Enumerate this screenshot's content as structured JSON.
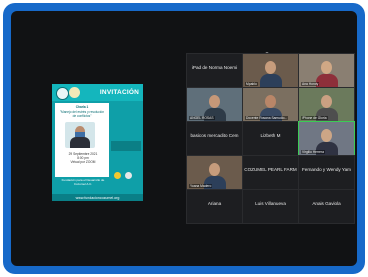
{
  "shared_screen": {
    "heading": "INVITACIÓN",
    "title_top": "Charla 1",
    "title": "\"Manejo del estrés y resolución de conflictos\"",
    "date": "29 Septiembre 2021",
    "time": "8:00 pm",
    "mode": "Virtual por ZOOM",
    "org": "Fundación para el Desarrollo de Cozumel A.C.",
    "footer": "www.fundacioncozumel.org"
  },
  "gallery": {
    "up_arrow": "︿",
    "down_arrow": "﹀",
    "tiles": [
      {
        "label": "iPad de Norma Noemi",
        "video": false
      },
      {
        "label": "Mpablo",
        "video": true
      },
      {
        "label": "Ana Hondy",
        "video": true
      },
      {
        "label": "ANGEL ROSAS",
        "video": true
      },
      {
        "label": "Docente Rosana Samudio...",
        "video": true
      },
      {
        "label": "iPhone de Gloria",
        "video": true
      },
      {
        "label": "basicos mercadito Cem",
        "video": false
      },
      {
        "label": "Lizbeth M",
        "video": false
      },
      {
        "label": "Virgilio Herrera",
        "video": true
      },
      {
        "label": "Yoana Madero",
        "video": true
      },
      {
        "label": "COZUMEL PEARL FARM",
        "video": false
      },
      {
        "label": "Fernando y Wendy Yam",
        "video": false
      },
      {
        "label": "Ariana",
        "video": false
      },
      {
        "label": "Luis Villanueva",
        "video": false
      },
      {
        "label": "Anais Gaviola",
        "video": false
      }
    ]
  }
}
